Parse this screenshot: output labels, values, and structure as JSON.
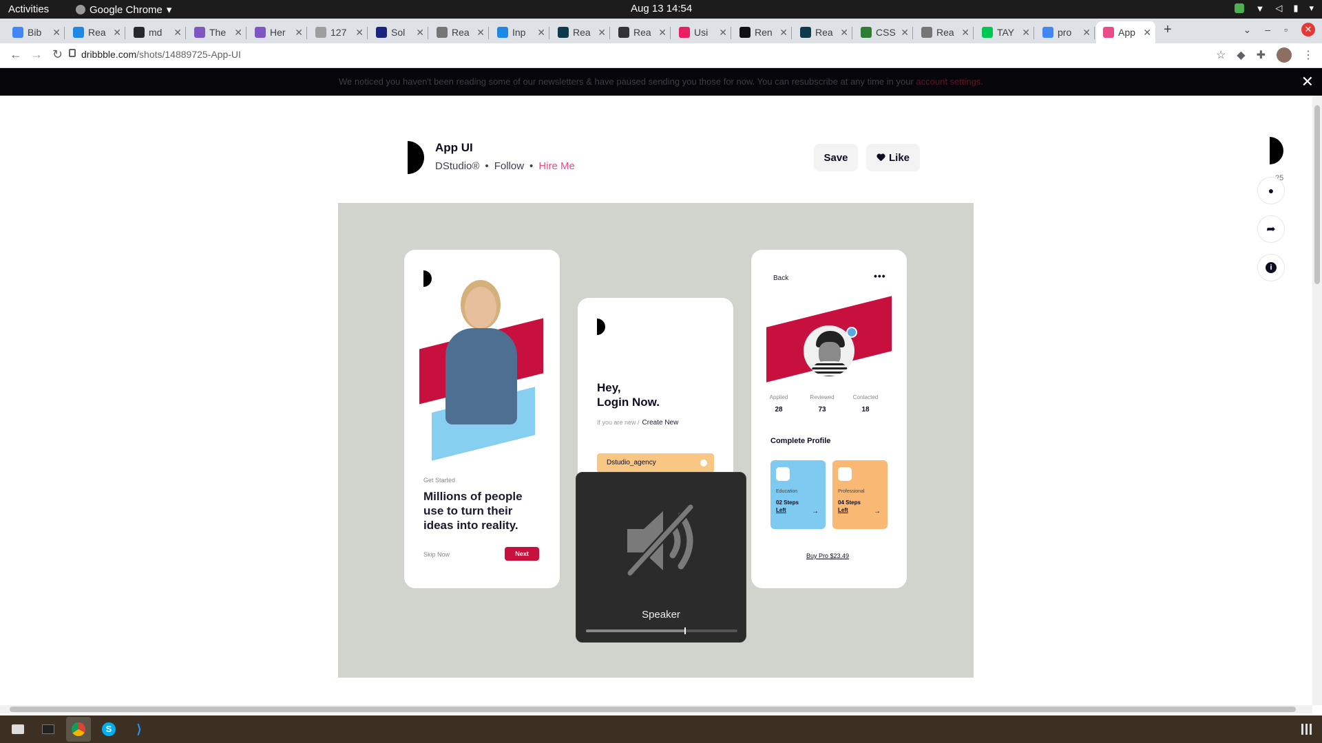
{
  "system": {
    "activities": "Activities",
    "app_name": "Google Chrome",
    "clock": "Aug 13  14:54"
  },
  "tabs": [
    {
      "label": "Bib",
      "color": "#4285f4"
    },
    {
      "label": "Rea",
      "color": "#1e88e5"
    },
    {
      "label": "md",
      "color": "#24292e"
    },
    {
      "label": "The",
      "color": "#7e57c2"
    },
    {
      "label": "Her",
      "color": "#7e57c2"
    },
    {
      "label": "127",
      "color": "#9e9e9e"
    },
    {
      "label": "Sol",
      "color": "#1a237e"
    },
    {
      "label": "Rea",
      "color": "#757575"
    },
    {
      "label": "Inp",
      "color": "#1e88e5"
    },
    {
      "label": "Rea",
      "color": "#0d3b4a"
    },
    {
      "label": "Rea",
      "color": "#333333"
    },
    {
      "label": "Usi",
      "color": "#e91e63"
    },
    {
      "label": "Ren",
      "color": "#111111"
    },
    {
      "label": "Rea",
      "color": "#0d3b4a"
    },
    {
      "label": "CSS",
      "color": "#2e7d32"
    },
    {
      "label": "Rea",
      "color": "#757575"
    },
    {
      "label": "TAY",
      "color": "#00c853"
    },
    {
      "label": "pro",
      "color": "#4285f4"
    },
    {
      "label": "App",
      "color": "#ea4c89"
    }
  ],
  "toolbar": {
    "url_host": "dribbble.com",
    "url_path": "/shots/14889725-App-UI"
  },
  "banner": {
    "text": "We noticed you haven't been reading some of our newsletters & have paused sending you those for now. You can resubscribe at any time in your",
    "link": "account settings."
  },
  "shot": {
    "title": "App UI",
    "author": "DStudio®",
    "follow": "Follow",
    "hire": "Hire Me",
    "save": "Save",
    "like": "Like",
    "comments_count": "25"
  },
  "phone1": {
    "small": "Get Started",
    "headline": "Millions of people use to turn their ideas into reality.",
    "skip": "Skip Now",
    "next": "Next"
  },
  "phone2": {
    "hey_line1": "Hey,",
    "hey_line2": "Login Now.",
    "new_q": "If you are new /",
    "create": "Create New",
    "field_value": "Dstudio_agency"
  },
  "phone3": {
    "back": "Back",
    "more": "•••",
    "stats": [
      {
        "label": "Applied",
        "value": "28"
      },
      {
        "label": "Reviewed",
        "value": "73"
      },
      {
        "label": "Contacted",
        "value": "18"
      }
    ],
    "complete": "Complete Profile",
    "cards": [
      {
        "label": "Education",
        "steps": "02 Steps",
        "left": "Left",
        "color": "#7fcaf0"
      },
      {
        "label": "Professional",
        "steps": "04 Steps",
        "left": "Left",
        "color": "#f9b873"
      }
    ],
    "buy": "Buy Pro $23.49"
  },
  "osd": {
    "label": "Speaker",
    "volume": 0.65,
    "muted": true
  },
  "colors": {
    "accent_red": "#c8103e",
    "dribbble_pink": "#ea4c89",
    "canvas_bg": "#d1d4cd"
  }
}
